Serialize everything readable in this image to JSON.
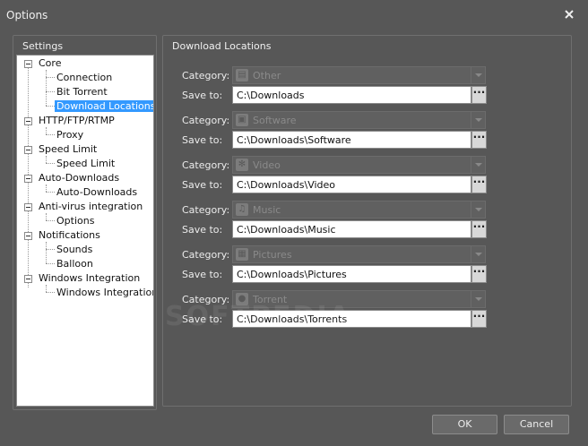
{
  "window": {
    "title": "Options"
  },
  "settings": {
    "title": "Settings",
    "tree": [
      {
        "label": "Core"
      },
      {
        "label": "Connection"
      },
      {
        "label": "Bit Torrent"
      },
      {
        "label": "Download Locations"
      },
      {
        "label": "HTTP/FTP/RTMP"
      },
      {
        "label": "Proxy"
      },
      {
        "label": "Speed Limit"
      },
      {
        "label": "Speed Limit"
      },
      {
        "label": "Auto-Downloads"
      },
      {
        "label": "Auto-Downloads"
      },
      {
        "label": "Anti-virus integration"
      },
      {
        "label": "Options"
      },
      {
        "label": "Notifications"
      },
      {
        "label": "Sounds"
      },
      {
        "label": "Balloon"
      },
      {
        "label": "Windows Integration"
      },
      {
        "label": "Windows Integration"
      }
    ],
    "selected": "Download Locations"
  },
  "locations": {
    "title": "Download Locations",
    "category_label": "Category:",
    "save_label": "Save to:",
    "browse_label": "···",
    "rows": [
      {
        "category": "Other",
        "icon": "document-icon",
        "path": "C:\\Downloads"
      },
      {
        "category": "Software",
        "icon": "software-icon",
        "path": "C:\\Downloads\\Software"
      },
      {
        "category": "Video",
        "icon": "film-reel-icon",
        "path": "C:\\Downloads\\Video"
      },
      {
        "category": "Music",
        "icon": "headphones-icon",
        "path": "C:\\Downloads\\Music"
      },
      {
        "category": "Pictures",
        "icon": "picture-icon",
        "path": "C:\\Downloads\\Pictures"
      },
      {
        "category": "Torrent",
        "icon": "torrent-icon",
        "path": "C:\\Downloads\\Torrents"
      }
    ]
  },
  "buttons": {
    "ok": "OK",
    "cancel": "Cancel"
  },
  "watermark": "SOFTPEDIA"
}
